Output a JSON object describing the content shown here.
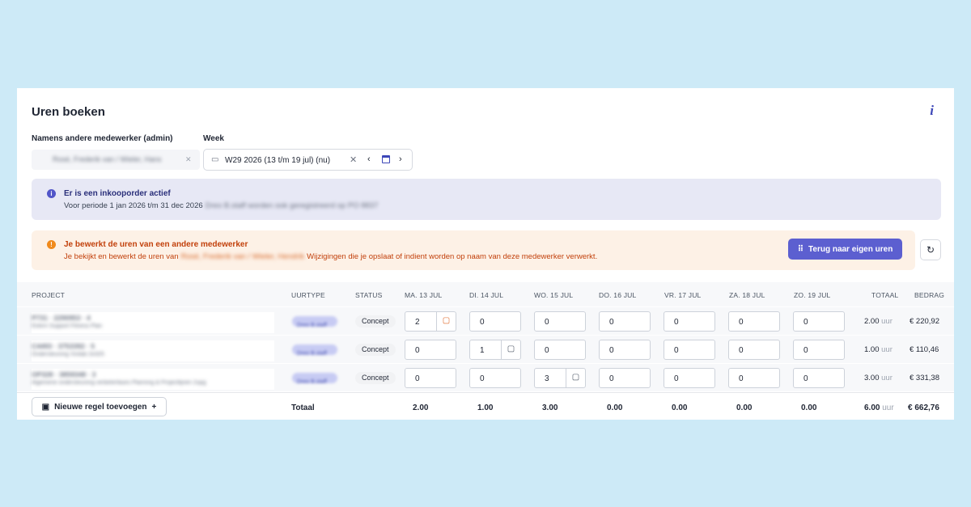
{
  "header": {
    "title": "Uren boeken",
    "info_icon": "i"
  },
  "filters": {
    "employee_label": "Namens andere medewerker (admin)",
    "employee_value": "Rosé, Frederik van / Wieler, Hans",
    "employee_clear": "✕",
    "week_label": "Week",
    "week_value": "W29 2026 (13 t/m 19 jul)  (nu)",
    "week_clear": "✕",
    "week_prev": "‹",
    "week_next": "›"
  },
  "info_banner": {
    "icon": "i",
    "title": "Er is een inkooporder actief",
    "text": "Voor periode 1 jan 2026 t/m 31 dec 2026",
    "hidden_text": "Dreo B.staff worden ook geregistreerd op PO 8837"
  },
  "warning_banner": {
    "icon": "!",
    "title": "Je bewerkt de uren van een andere medewerker",
    "text_before": "Je bekijkt en bewerkt de uren van",
    "hidden_name": "Rosé, Frederik van / Wieler, Hendrik",
    "text_after": "Wijzigingen die je opslaat of indient worden op naam van deze medewerker verwerkt.",
    "back_button": "Terug naar eigen uren"
  },
  "table": {
    "headers": {
      "project": "PROJECT",
      "uurtype": "UURTYPE",
      "status": "STATUS",
      "d1": "MA. 13 JUL",
      "d2": "DI. 14 JUL",
      "d3": "WO. 15 JUL",
      "d4": "DO. 16 JUL",
      "d5": "VR. 17 JUL",
      "d6": "ZA. 18 JUL",
      "d7": "ZO. 19 JUL",
      "totaal": "TOTAAL",
      "bedrag": "BEDRAG"
    },
    "rows": [
      {
        "code": "P731 · 2290953 · 4",
        "desc": "Extern Support Fitness Plan",
        "uurtype": "Dreo B.staff",
        "status": "Concept",
        "hours": [
          "2",
          "0",
          "0",
          "0",
          "0",
          "0",
          "0"
        ],
        "total": "2.00",
        "unit": "uur",
        "amount": "€ 220,92"
      },
      {
        "code": "C4493 · 3753392 · 5",
        "desc": "Ondersteuning Vivilab 2e325",
        "uurtype": "Dreo B.staff",
        "status": "Concept",
        "hours": [
          "0",
          "1",
          "0",
          "0",
          "0",
          "0",
          "0"
        ],
        "total": "1.00",
        "unit": "uur",
        "amount": "€ 110,46"
      },
      {
        "code": "OP328 · 3859348 · 3",
        "desc": "Algemene ondersteuning verbeterfases Planning & Projectlijnen 2upg",
        "uurtype": "Dreo B.staff",
        "status": "Concept",
        "hours": [
          "0",
          "0",
          "3",
          "0",
          "0",
          "0",
          "0"
        ],
        "total": "3.00",
        "unit": "uur",
        "amount": "€ 331,38"
      }
    ],
    "footer": {
      "add_button": "Nieuwe regel toevoegen",
      "add_plus": "+",
      "total_label": "Totaal",
      "day_totals": [
        "2.00",
        "1.00",
        "3.00",
        "0.00",
        "0.00",
        "0.00",
        "0.00"
      ],
      "grand_total": "6.00",
      "unit": "uur",
      "grand_amount": "€ 662,76"
    }
  },
  "colors": {
    "accent": "#5c5fd0",
    "warning": "#c2410c",
    "comment_active": "#e0692a"
  }
}
